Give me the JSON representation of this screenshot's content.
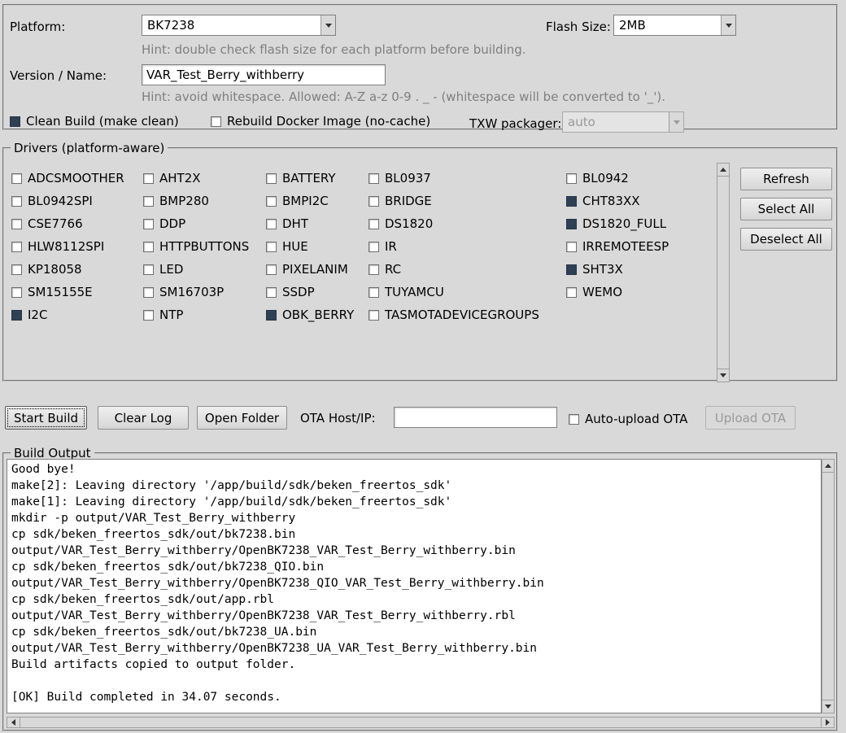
{
  "colors": {
    "background": "#d9d9d9",
    "checkbox_checked": "#2e4053",
    "hint_text": "#7f7f7f",
    "disabled_text": "#9a9a9a"
  },
  "config": {
    "platform_label": "Platform:",
    "platform_value": "BK7238",
    "flash_label": "Flash Size:",
    "flash_value": "2MB",
    "platform_hint": "Hint: double check flash size for each platform before building.",
    "version_label": "Version / Name:",
    "version_value": "VAR_Test_Berry_withberry",
    "version_hint": "Hint: avoid whitespace. Allowed: A-Z a-z 0-9 . _ - (whitespace will be converted to '_').",
    "clean_build": {
      "label": "Clean Build (make clean)",
      "checked": true
    },
    "rebuild_docker": {
      "label": "Rebuild Docker Image (no-cache)",
      "checked": false
    },
    "txw_label": "TXW packager:",
    "txw_value": "auto"
  },
  "drivers": {
    "title": "Drivers (platform-aware)",
    "refresh_label": "Refresh",
    "select_all_label": "Select All",
    "deselect_all_label": "Deselect All",
    "items": [
      {
        "label": "ADCSMOOTHER",
        "checked": false
      },
      {
        "label": "AHT2X",
        "checked": false
      },
      {
        "label": "BATTERY",
        "checked": false
      },
      {
        "label": "BL0937",
        "checked": false
      },
      {
        "label": "BL0942",
        "checked": false
      },
      {
        "label": "BL0942SPI",
        "checked": false
      },
      {
        "label": "BMP280",
        "checked": false
      },
      {
        "label": "BMPI2C",
        "checked": false
      },
      {
        "label": "BRIDGE",
        "checked": false
      },
      {
        "label": "CHT83XX",
        "checked": true
      },
      {
        "label": "CSE7766",
        "checked": false
      },
      {
        "label": "DDP",
        "checked": false
      },
      {
        "label": "DHT",
        "checked": false
      },
      {
        "label": "DS1820",
        "checked": false
      },
      {
        "label": "DS1820_FULL",
        "checked": true
      },
      {
        "label": "HLW8112SPI",
        "checked": false
      },
      {
        "label": "HTTPBUTTONS",
        "checked": false
      },
      {
        "label": "HUE",
        "checked": false
      },
      {
        "label": "IR",
        "checked": false
      },
      {
        "label": "IRREMOTEESP",
        "checked": false
      },
      {
        "label": "KP18058",
        "checked": false
      },
      {
        "label": "LED",
        "checked": false
      },
      {
        "label": "PIXELANIM",
        "checked": false
      },
      {
        "label": "RC",
        "checked": false
      },
      {
        "label": "SHT3X",
        "checked": true
      },
      {
        "label": "SM15155E",
        "checked": false
      },
      {
        "label": "SM16703P",
        "checked": false
      },
      {
        "label": "SSDP",
        "checked": false
      },
      {
        "label": "TUYAMCU",
        "checked": false
      },
      {
        "label": "WEMO",
        "checked": false
      },
      {
        "label": "I2C",
        "checked": true
      },
      {
        "label": "NTP",
        "checked": false
      },
      {
        "label": "OBK_BERRY",
        "checked": true
      },
      {
        "label": "TASMOTADEVICEGROUPS",
        "checked": false
      }
    ]
  },
  "actions": {
    "start_build_label": "Start Build",
    "clear_log_label": "Clear Log",
    "open_folder_label": "Open Folder",
    "ota_label": "OTA Host/IP:",
    "ota_value": "",
    "auto_upload": {
      "label": "Auto-upload OTA",
      "checked": false
    },
    "upload_ota_label": "Upload OTA"
  },
  "build_output": {
    "title": "Build Output",
    "lines": [
      "Good bye!",
      "make[2]: Leaving directory '/app/build/sdk/beken_freertos_sdk'",
      "make[1]: Leaving directory '/app/build/sdk/beken_freertos_sdk'",
      "mkdir -p output/VAR_Test_Berry_withberry",
      "cp sdk/beken_freertos_sdk/out/bk7238.bin",
      "output/VAR_Test_Berry_withberry/OpenBK7238_VAR_Test_Berry_withberry.bin",
      "cp sdk/beken_freertos_sdk/out/bk7238_QIO.bin",
      "output/VAR_Test_Berry_withberry/OpenBK7238_QIO_VAR_Test_Berry_withberry.bin",
      "cp sdk/beken_freertos_sdk/out/app.rbl",
      "output/VAR_Test_Berry_withberry/OpenBK7238_VAR_Test_Berry_withberry.rbl",
      "cp sdk/beken_freertos_sdk/out/bk7238_UA.bin",
      "output/VAR_Test_Berry_withberry/OpenBK7238_UA_VAR_Test_Berry_withberry.bin",
      "Build artifacts copied to output folder.",
      "",
      "[OK] Build completed in 34.07 seconds."
    ]
  }
}
